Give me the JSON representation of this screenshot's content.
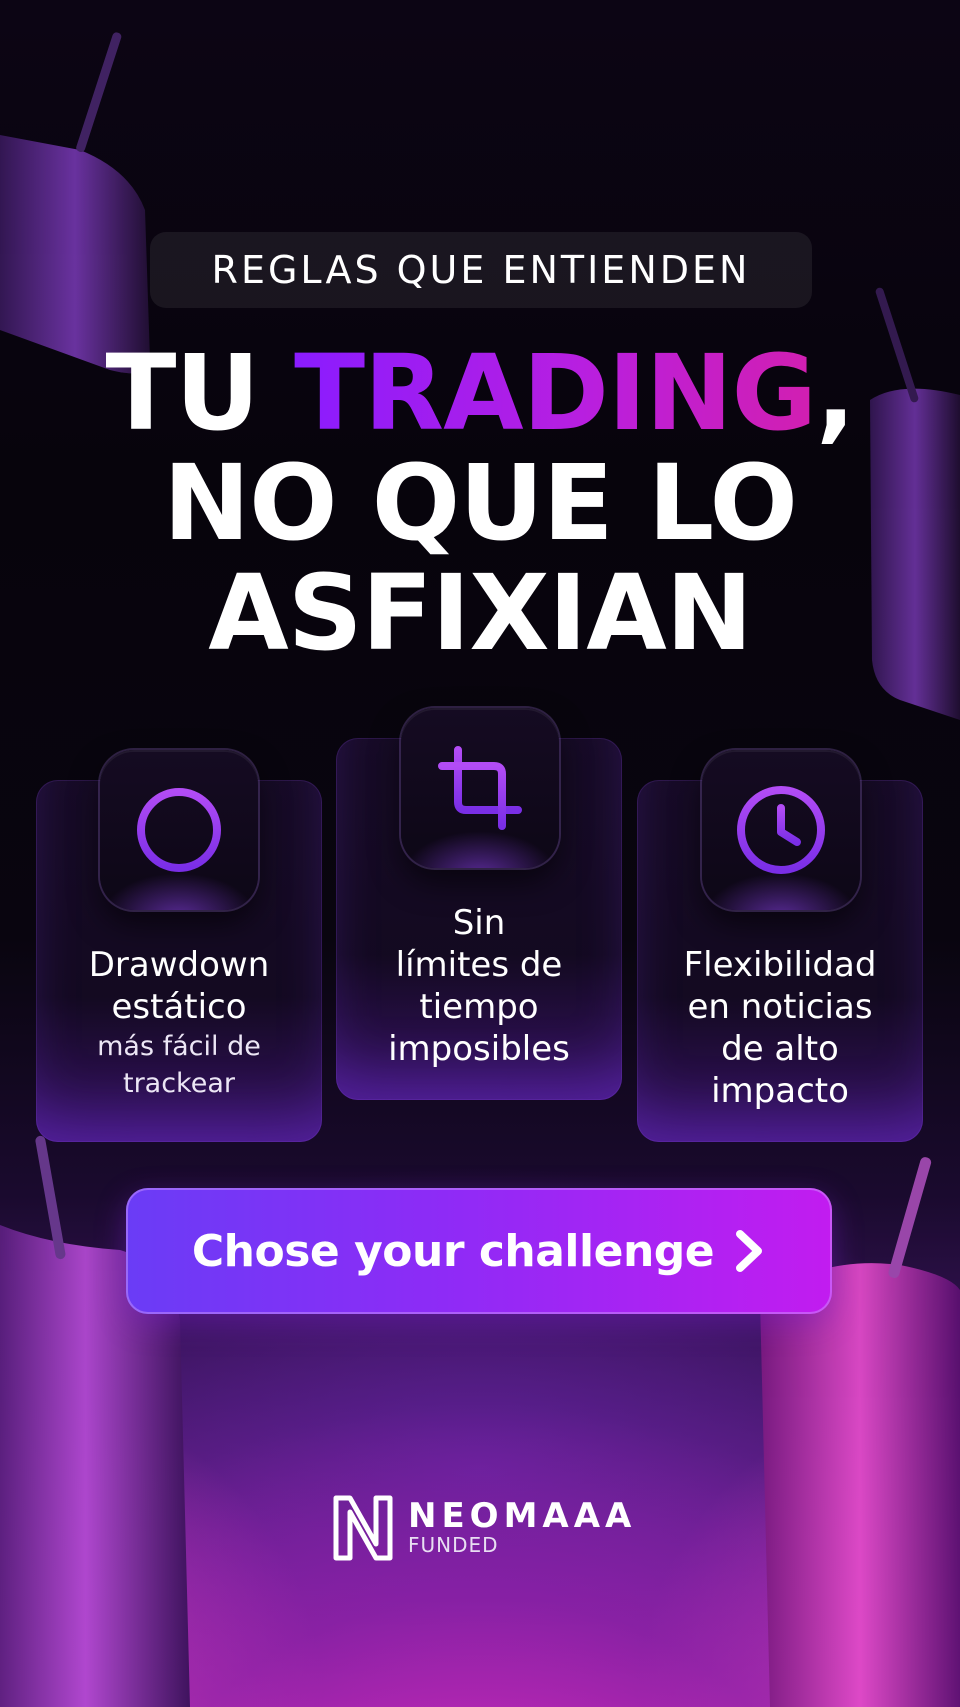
{
  "eyebrow": "REGLAS QUE ENTIENDEN",
  "headline": {
    "line1_start": "TU ",
    "line1_highlight": "TRADING",
    "line1_end": ",",
    "line2": "NO QUE LO",
    "line3": "ASFIXIAN"
  },
  "features": [
    {
      "icon": "crosshair-icon",
      "title_line1": "Drawdown",
      "title_line2": "estático",
      "detail_line1": "más fácil de",
      "detail_line2": "trackear"
    },
    {
      "icon": "crop-icon",
      "line1": "Sin",
      "line2": "límites de",
      "line3": "tiempo",
      "line4": "imposibles"
    },
    {
      "icon": "clock-icon",
      "line1": "Flexibilidad",
      "line2": "en noticias",
      "line3": "de alto",
      "line4": "impacto"
    }
  ],
  "cta": {
    "label": "Chose your challenge",
    "icon": "chevron-right-icon"
  },
  "brand": {
    "name": "NEOMAAA",
    "sub": "FUNDED"
  },
  "colors": {
    "accent_start": "#6a3cf6",
    "accent_end": "#c21cf0",
    "highlight": "#a21ef0",
    "icon_purple": "#9b3cf2"
  }
}
